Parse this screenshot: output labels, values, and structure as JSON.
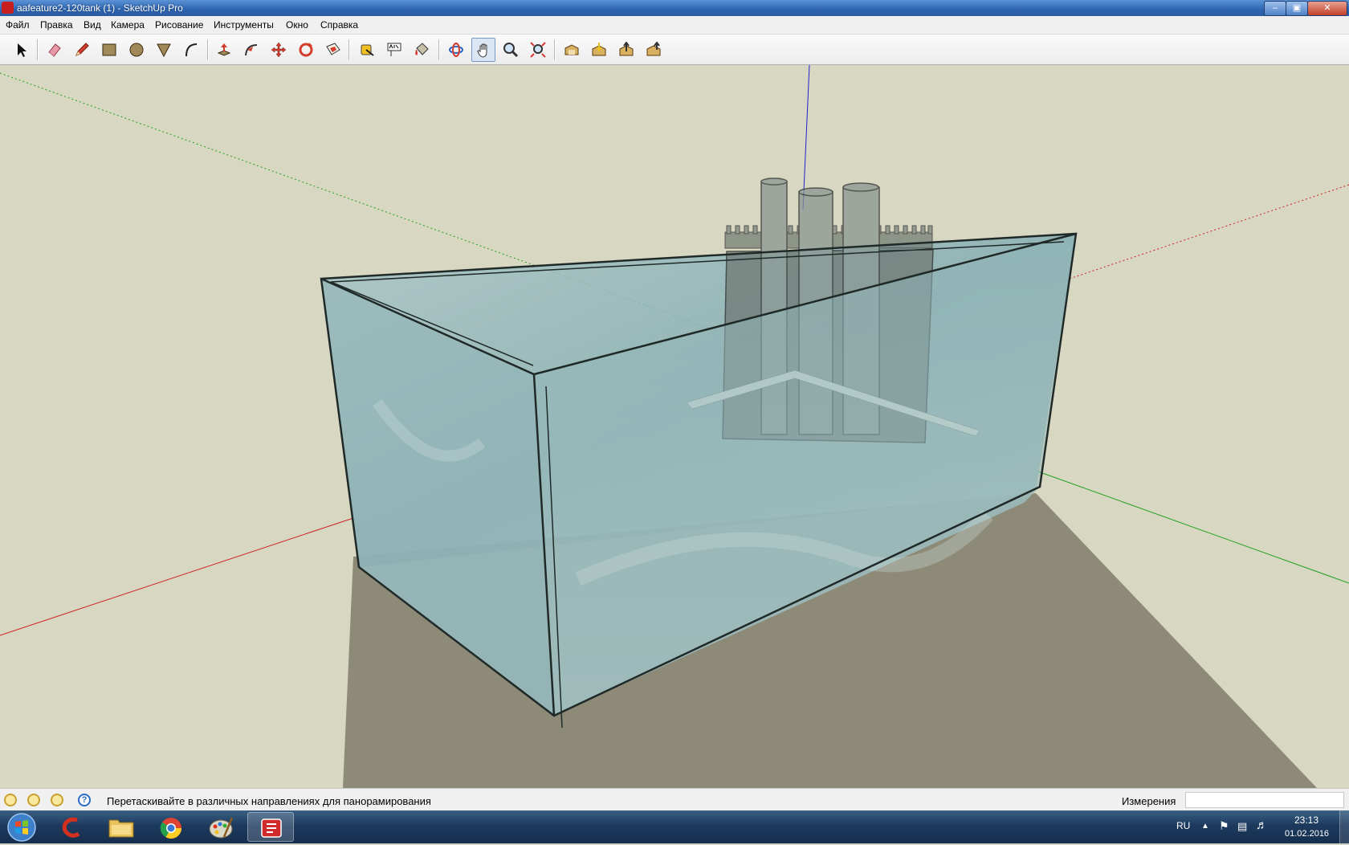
{
  "window": {
    "title": "aafeature2-120tank (1) - SketchUp Pro",
    "controls": [
      "minimize",
      "maximize",
      "close"
    ]
  },
  "menu": {
    "items": [
      "Файл",
      "Правка",
      "Вид",
      "Камера",
      "Рисование",
      "Инструменты",
      "Окно",
      "Справка"
    ]
  },
  "toolbar": {
    "tools": [
      {
        "name": "select",
        "icon": "arrow-icon"
      },
      {
        "name": "eraser",
        "icon": "eraser-icon"
      },
      {
        "name": "line",
        "icon": "pencil-icon"
      },
      {
        "name": "rectangle",
        "icon": "rectangle-icon"
      },
      {
        "name": "circle",
        "icon": "circle-icon"
      },
      {
        "name": "polygon",
        "icon": "polygon-icon"
      },
      {
        "name": "arc",
        "icon": "arc-icon"
      },
      {
        "name": "push-pull",
        "icon": "push-pull-icon"
      },
      {
        "name": "follow-me",
        "icon": "follow-me-icon"
      },
      {
        "name": "move",
        "icon": "move-icon"
      },
      {
        "name": "rotate",
        "icon": "rotate-icon"
      },
      {
        "name": "offset",
        "icon": "offset-icon"
      },
      {
        "name": "tape-measure",
        "icon": "tape-measure-icon"
      },
      {
        "name": "text",
        "icon": "text-icon"
      },
      {
        "name": "paint-bucket",
        "icon": "paint-bucket-icon"
      },
      {
        "name": "orbit",
        "icon": "orbit-icon"
      },
      {
        "name": "pan",
        "icon": "hand-icon",
        "active": true
      },
      {
        "name": "zoom",
        "icon": "zoom-icon"
      },
      {
        "name": "zoom-extents",
        "icon": "zoom-extents-icon"
      },
      {
        "name": "warehouse",
        "icon": "warehouse-icon"
      },
      {
        "name": "get-models",
        "icon": "get-models-icon"
      },
      {
        "name": "share-model",
        "icon": "share-model-icon"
      },
      {
        "name": "share-component",
        "icon": "share-component-icon"
      }
    ]
  },
  "colors": {
    "sky": "#d8d7c1",
    "ground": "#8e8a78",
    "glass": "#8fb4b8",
    "axis_red": "#cc2222",
    "axis_green": "#22a022",
    "axis_blue": "#2222cc"
  },
  "status": {
    "icons": [
      "geo-location-icon",
      "credits-icon",
      "copyright-icon",
      "help-icon"
    ],
    "text": "Перетаскивайте в различных направлениях для панорамирования",
    "measurements_label": "Измерения",
    "measurements_value": ""
  },
  "taskbar": {
    "apps": [
      {
        "name": "ccleaner",
        "icon": "ccleaner-icon"
      },
      {
        "name": "explorer",
        "icon": "folder-icon"
      },
      {
        "name": "chrome",
        "icon": "chrome-icon"
      },
      {
        "name": "paint",
        "icon": "paint-palette-icon"
      },
      {
        "name": "sketchup",
        "icon": "sketchup-icon",
        "active": true
      }
    ],
    "tray": {
      "language": "RU",
      "time": "23:13",
      "date": "01.02.2016"
    }
  }
}
